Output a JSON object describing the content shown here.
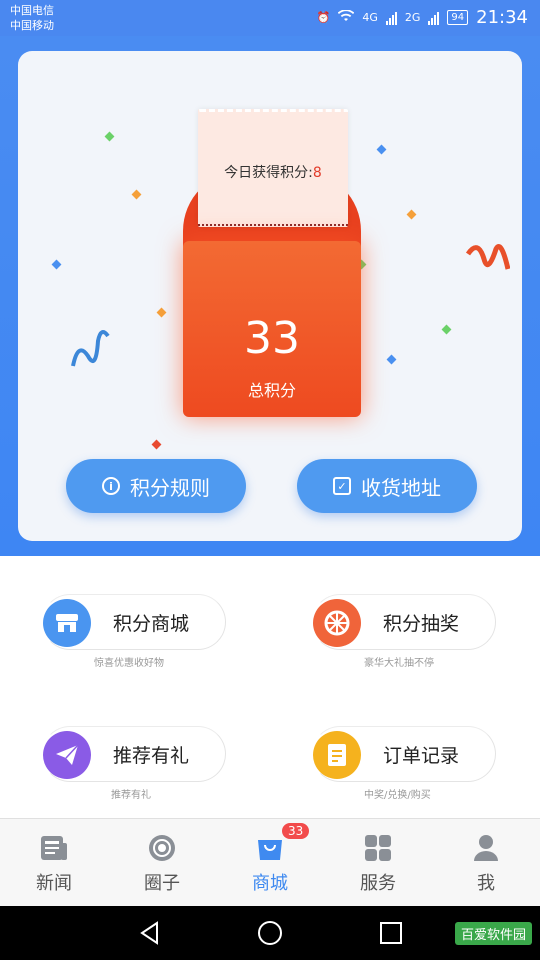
{
  "status": {
    "carrier1": "中国电信",
    "carrier2": "中国移动",
    "net1": "4G",
    "net2": "2G",
    "battery": "94",
    "time": "21:34"
  },
  "points": {
    "today_label": "今日获得积分:",
    "today_value": "8",
    "total_value": "33",
    "total_label": "总积分"
  },
  "buttons": {
    "rules": "积分规则",
    "address": "收货地址"
  },
  "menu": [
    {
      "title": "积分商城",
      "sub": "惊喜优惠收好物",
      "icon": "store-icon",
      "color": "#4a95f0"
    },
    {
      "title": "积分抽奖",
      "sub": "豪华大礼抽不停",
      "icon": "wheel-icon",
      "color": "#f0643a"
    },
    {
      "title": "推荐有礼",
      "sub": "推荐有礼",
      "icon": "paper-plane-icon",
      "color": "#8a5be6"
    },
    {
      "title": "订单记录",
      "sub": "中奖/兑换/购买",
      "icon": "order-icon",
      "color": "#f5b21e"
    }
  ],
  "tabs": [
    {
      "label": "新闻",
      "icon": "news-icon"
    },
    {
      "label": "圈子",
      "icon": "circle-icon"
    },
    {
      "label": "商城",
      "icon": "shop-bag-icon",
      "badge": "33"
    },
    {
      "label": "服务",
      "icon": "grid-icon"
    },
    {
      "label": "我",
      "icon": "person-icon"
    }
  ],
  "watermark": "百爱软件园",
  "colors": {
    "primary": "#3f8af0",
    "accent": "#f05a2a",
    "badge": "#f24b4b"
  }
}
